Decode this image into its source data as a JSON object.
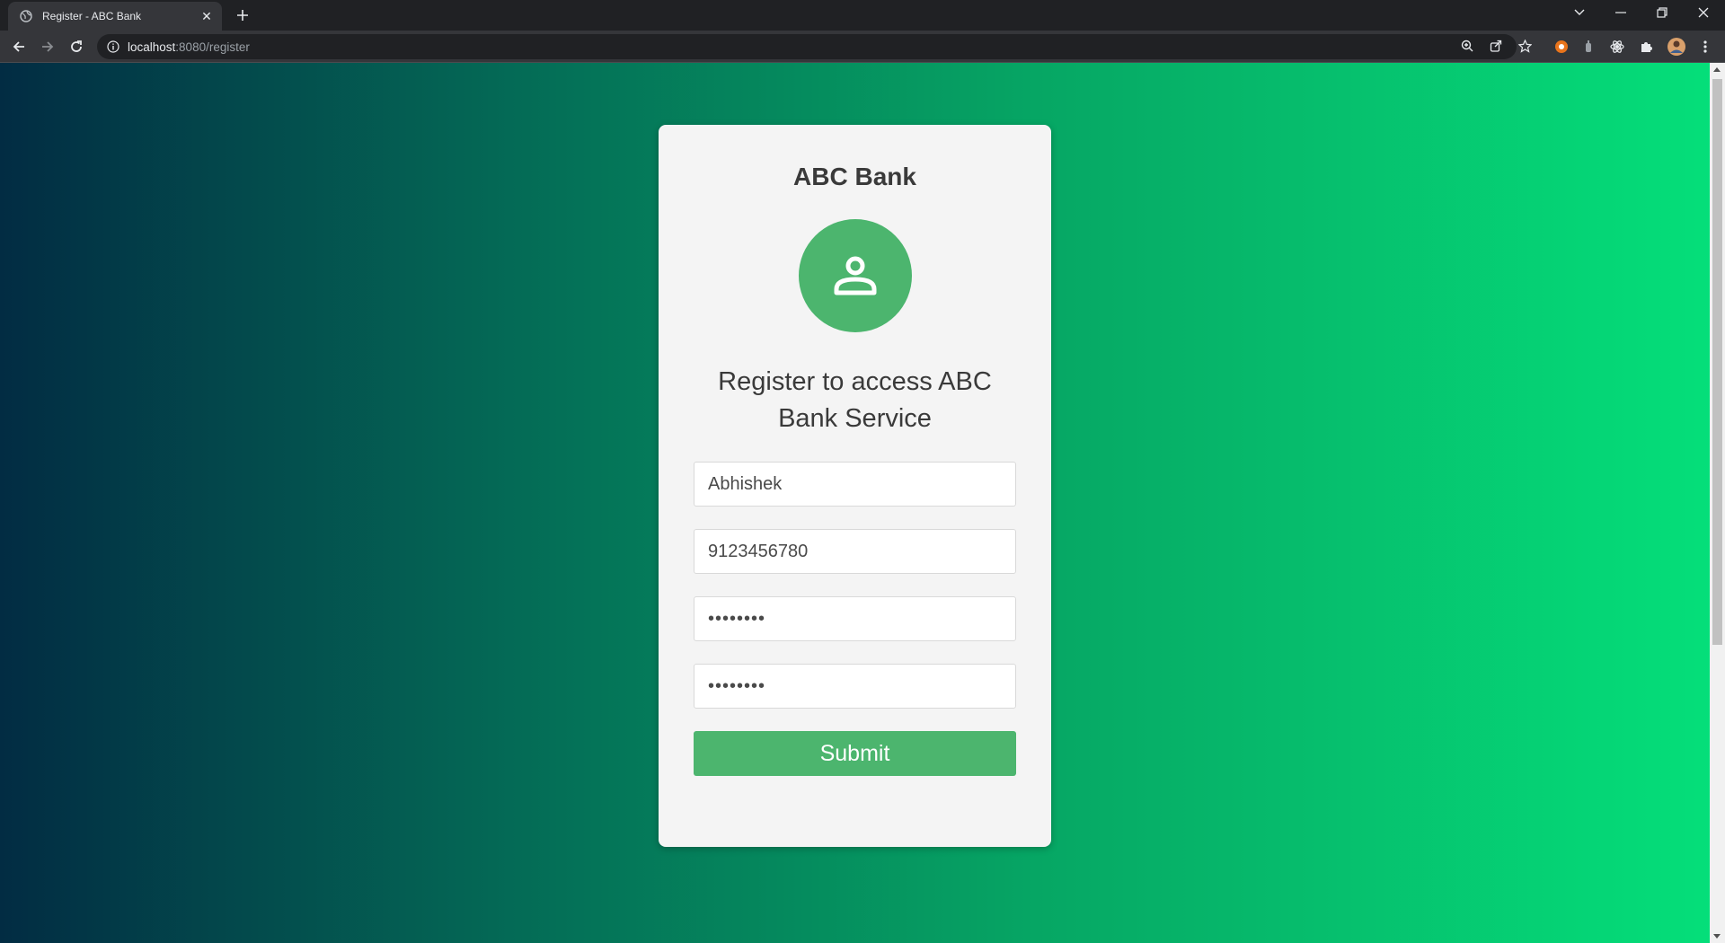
{
  "browser": {
    "tab_title": "Register - ABC Bank",
    "close_tab_glyph": "✕",
    "url_host": "localhost",
    "url_path": ":8080/register"
  },
  "page": {
    "brand": "ABC Bank",
    "heading": "Register to access ABC Bank Service",
    "fields": {
      "name_value": "Abhishek",
      "phone_value": "9123456780",
      "password_value": "abcd1234",
      "confirm_password_value": "abcd1234"
    },
    "submit_label": "Submit"
  },
  "colors": {
    "accent": "#4cb56e",
    "card_bg": "#f4f4f4",
    "gradient_start": "#022c43",
    "gradient_end": "#05e07a"
  },
  "icons": [
    "globe-icon",
    "close-icon",
    "plus-icon",
    "chevron-down-icon",
    "minimize-icon",
    "restore-icon",
    "window-close-icon",
    "back-arrow-icon",
    "forward-arrow-icon",
    "reload-icon",
    "info-icon",
    "zoom-icon",
    "share-icon",
    "star-icon",
    "extension-icon",
    "puzzle-icon",
    "profile-avatar",
    "kebab-menu-icon",
    "user-icon"
  ]
}
